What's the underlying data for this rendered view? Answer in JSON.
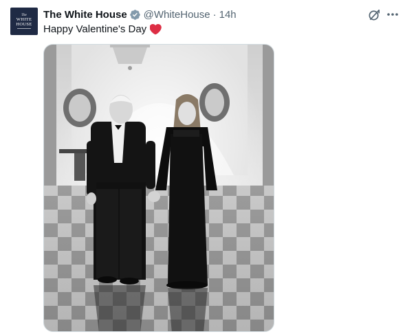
{
  "account": {
    "display_name": "The White House",
    "handle": "@WhiteHouse",
    "separator": "·",
    "time": "14h",
    "avatar_lines": [
      "The",
      "WHITE",
      "HOUSE"
    ]
  },
  "tweet": {
    "text": "Happy Valentine's Day"
  },
  "icons": {
    "verified": "verified-badge-icon",
    "heart": "red-heart-emoji-icon",
    "grok": "grok-icon",
    "more": "more-icon"
  },
  "colors": {
    "verified_badge": "#829aab",
    "heart": "#dd2e44",
    "secondary_text": "#536471",
    "avatar_bg": "#1f2a44"
  }
}
